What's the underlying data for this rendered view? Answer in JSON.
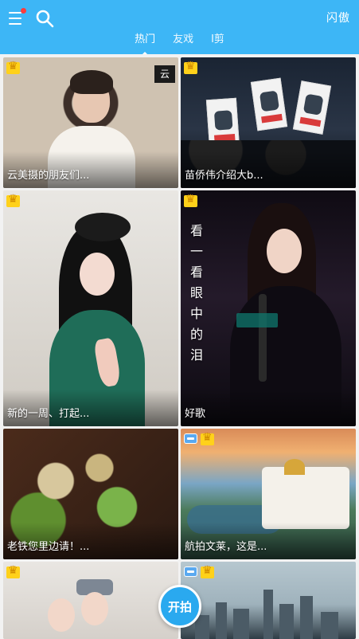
{
  "header": {
    "menu_icon": "menu-icon",
    "search_icon": "search-icon",
    "right_action": "闪傲",
    "tabs": [
      {
        "label": "热门",
        "active": true
      },
      {
        "label": "友戏",
        "active": false
      },
      {
        "label": "I剪",
        "active": false
      }
    ],
    "accent_color": "#3db6f6"
  },
  "feed": {
    "cards": [
      {
        "caption": "云美摄的朋友们...",
        "badges": [
          "crown-icon"
        ],
        "watermark": "云"
      },
      {
        "caption": "苗侨伟介绍大b...",
        "badges": [
          "crown-icon"
        ]
      },
      {
        "caption": "新的一周、打起...",
        "badges": [
          "crown-icon"
        ]
      },
      {
        "caption": "好歌",
        "badges": [
          "crown-icon"
        ],
        "overlay_text": "看一看眼中的泪"
      },
      {
        "caption": "老铁您里边请！...",
        "badges": []
      },
      {
        "caption": "航拍文莱，这是...",
        "badges": [
          "film-icon",
          "crown-icon"
        ]
      },
      {
        "caption": "",
        "badges": [
          "crown-icon"
        ]
      },
      {
        "caption": "",
        "badges": [
          "film-icon",
          "crown-icon"
        ]
      }
    ]
  },
  "fab": {
    "label": "开拍"
  }
}
